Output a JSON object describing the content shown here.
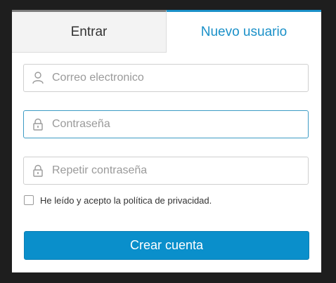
{
  "tabs": {
    "login_label": "Entrar",
    "register_label": "Nuevo usuario",
    "active": "register"
  },
  "form": {
    "email": {
      "value": "",
      "placeholder": "Correo electronico",
      "icon": "user-icon"
    },
    "password": {
      "value": "",
      "placeholder": "Contraseña",
      "icon": "lock-icon",
      "focused": true
    },
    "repeat_password": {
      "value": "",
      "placeholder": "Repetir contraseña",
      "icon": "lock-icon"
    },
    "consent": {
      "label": "He leído y acepto la política de privacidad.",
      "checked": false
    },
    "submit_label": "Crear cuenta"
  },
  "colors": {
    "accent": "#1a90c8",
    "button": "#0a8fcb",
    "inactive_tab_border": "#7d7d7d",
    "background": "#1e1e1e"
  }
}
